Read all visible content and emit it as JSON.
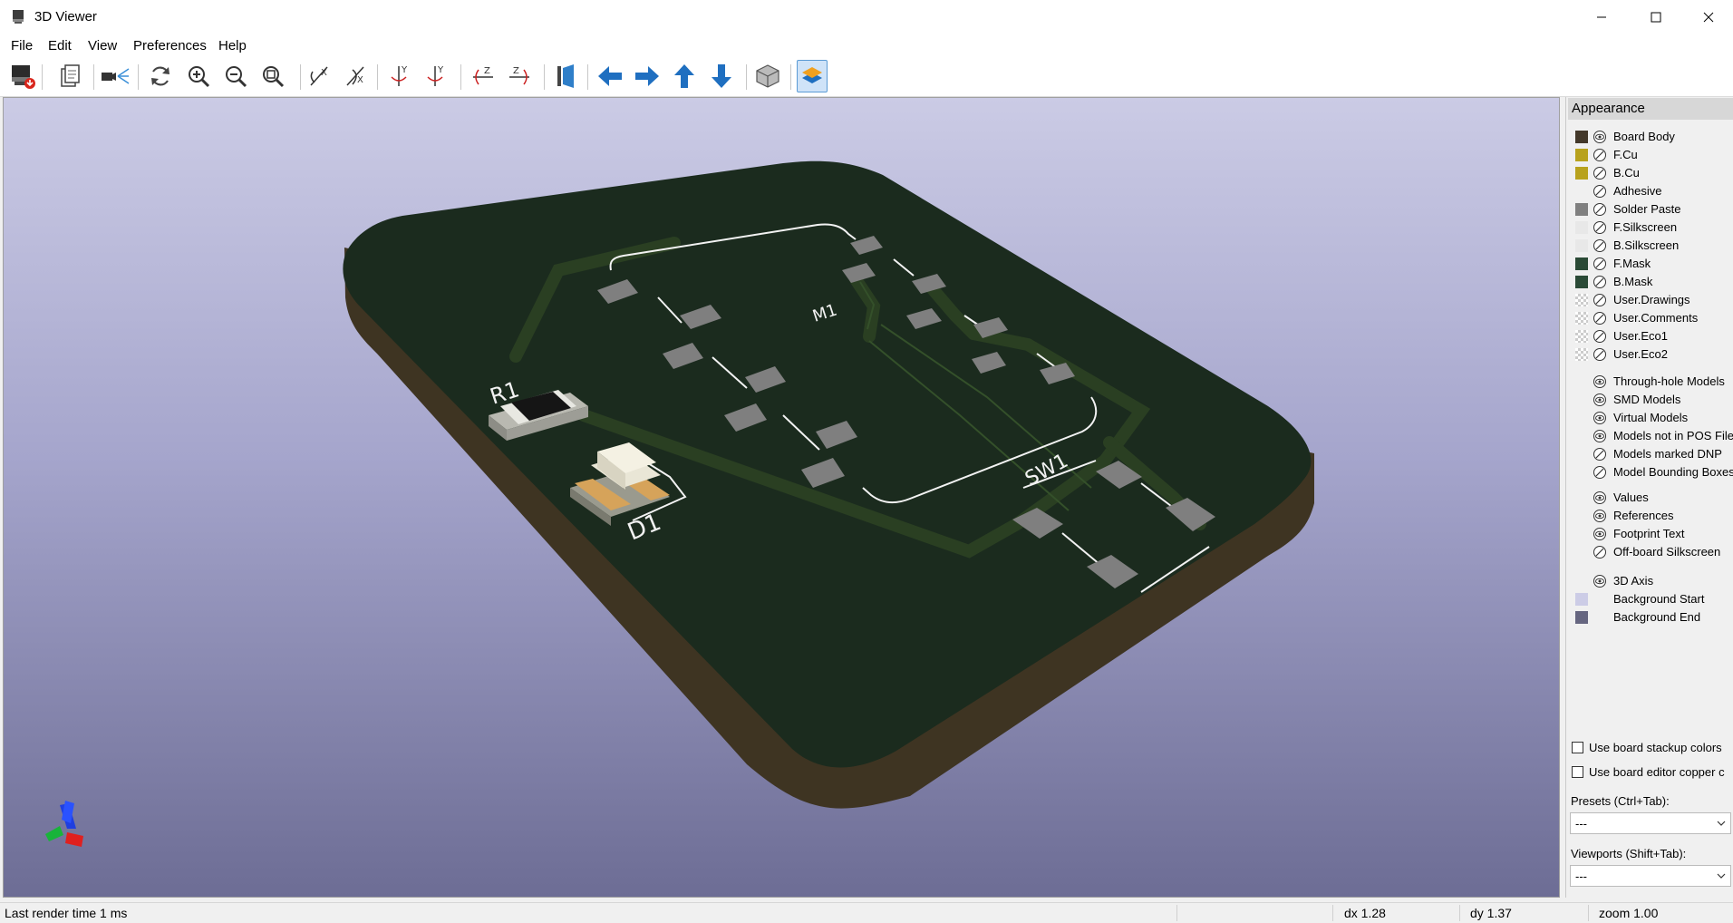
{
  "window": {
    "title": "3D Viewer",
    "icon": "kicad-3d-viewer-icon",
    "controls": [
      "minimize-icon",
      "maximize-icon",
      "close-icon"
    ]
  },
  "menu": [
    "File",
    "Edit",
    "View",
    "Preferences",
    "Help"
  ],
  "toolbar": {
    "buttons": [
      {
        "name": "render-raytracing-icon"
      },
      {
        "name": "copy-image-icon"
      },
      {
        "name": "lighting-settings-icon"
      },
      {
        "name": "reload-icon"
      },
      {
        "name": "zoom-in-icon"
      },
      {
        "name": "zoom-out-icon"
      },
      {
        "name": "zoom-fit-icon"
      },
      {
        "name": "rotate-x-ccw-icon"
      },
      {
        "name": "rotate-x-cw-icon"
      },
      {
        "name": "rotate-y-ccw-icon"
      },
      {
        "name": "rotate-y-cw-icon"
      },
      {
        "name": "rotate-z-ccw-icon"
      },
      {
        "name": "rotate-z-cw-icon"
      },
      {
        "name": "flip-board-icon"
      },
      {
        "name": "move-left-icon"
      },
      {
        "name": "move-right-icon"
      },
      {
        "name": "move-up-icon"
      },
      {
        "name": "move-down-icon"
      },
      {
        "name": "toggle-orthographic-icon"
      },
      {
        "name": "layers-manager-icon",
        "active": true
      }
    ]
  },
  "board_labels": {
    "r1": "R1",
    "d1": "D1",
    "m1": "M1",
    "sw1": "SW1"
  },
  "colors": {
    "board_body": "#43382a",
    "f_cu": "#b8a21d",
    "b_cu": "#b8a21d",
    "solder_paste": "#808080",
    "silkscreen": "#f2f2f2",
    "f_mask": "#2a4a36",
    "b_mask": "#2a4a36",
    "bg_start": "#cccce6",
    "bg_end": "#666680",
    "accent_active": "#5b9bd5"
  },
  "appearance": {
    "title": "Appearance",
    "layers": [
      {
        "label": "Board Body",
        "swatch": "#43382a",
        "visible": true
      },
      {
        "label": "F.Cu",
        "swatch": "#b8a21d",
        "visible": false
      },
      {
        "label": "B.Cu",
        "swatch": "#b8a21d",
        "visible": false
      },
      {
        "label": "Adhesive",
        "swatch": "",
        "visible": false
      },
      {
        "label": "Solder Paste",
        "swatch": "#808080",
        "visible": false
      },
      {
        "label": "F.Silkscreen",
        "swatch": "#e8e8e8",
        "visible": false
      },
      {
        "label": "B.Silkscreen",
        "swatch": "#e8e8e8",
        "visible": false
      },
      {
        "label": "F.Mask",
        "swatch": "#2a4a36",
        "visible": false
      },
      {
        "label": "B.Mask",
        "swatch": "#2a4a36",
        "visible": false
      },
      {
        "label": "User.Drawings",
        "swatch": "checker",
        "visible": false
      },
      {
        "label": "User.Comments",
        "swatch": "checker",
        "visible": false
      },
      {
        "label": "User.Eco1",
        "swatch": "checker",
        "visible": false
      },
      {
        "label": "User.Eco2",
        "swatch": "checker",
        "visible": false
      }
    ],
    "models": [
      {
        "label": "Through-hole Models",
        "visible": true
      },
      {
        "label": "SMD Models",
        "visible": true
      },
      {
        "label": "Virtual Models",
        "visible": true
      },
      {
        "label": "Models not in POS File",
        "visible": true
      },
      {
        "label": "Models marked DNP",
        "visible": false
      },
      {
        "label": "Model Bounding Boxes",
        "visible": false
      }
    ],
    "texts": [
      {
        "label": "Values",
        "visible": true
      },
      {
        "label": "References",
        "visible": true
      },
      {
        "label": "Footprint Text",
        "visible": true
      },
      {
        "label": "Off-board Silkscreen",
        "visible": false
      }
    ],
    "misc": [
      {
        "label": "3D Axis",
        "swatch": "",
        "visible": true
      },
      {
        "label": "Background Start",
        "swatch": "#cccce6",
        "visible": null
      },
      {
        "label": "Background End",
        "swatch": "#666680",
        "visible": null
      }
    ],
    "use_stackup_colors": "Use board stackup colors",
    "use_editor_copper": "Use board editor copper c",
    "presets_label": "Presets (Ctrl+Tab):",
    "presets_value": "---",
    "viewports_label": "Viewports (Shift+Tab):",
    "viewports_value": "---"
  },
  "status": {
    "render_time": "Last render time 1 ms",
    "dx": "dx 1.28",
    "dy": "dy 1.37",
    "zoom": "zoom 1.00"
  }
}
